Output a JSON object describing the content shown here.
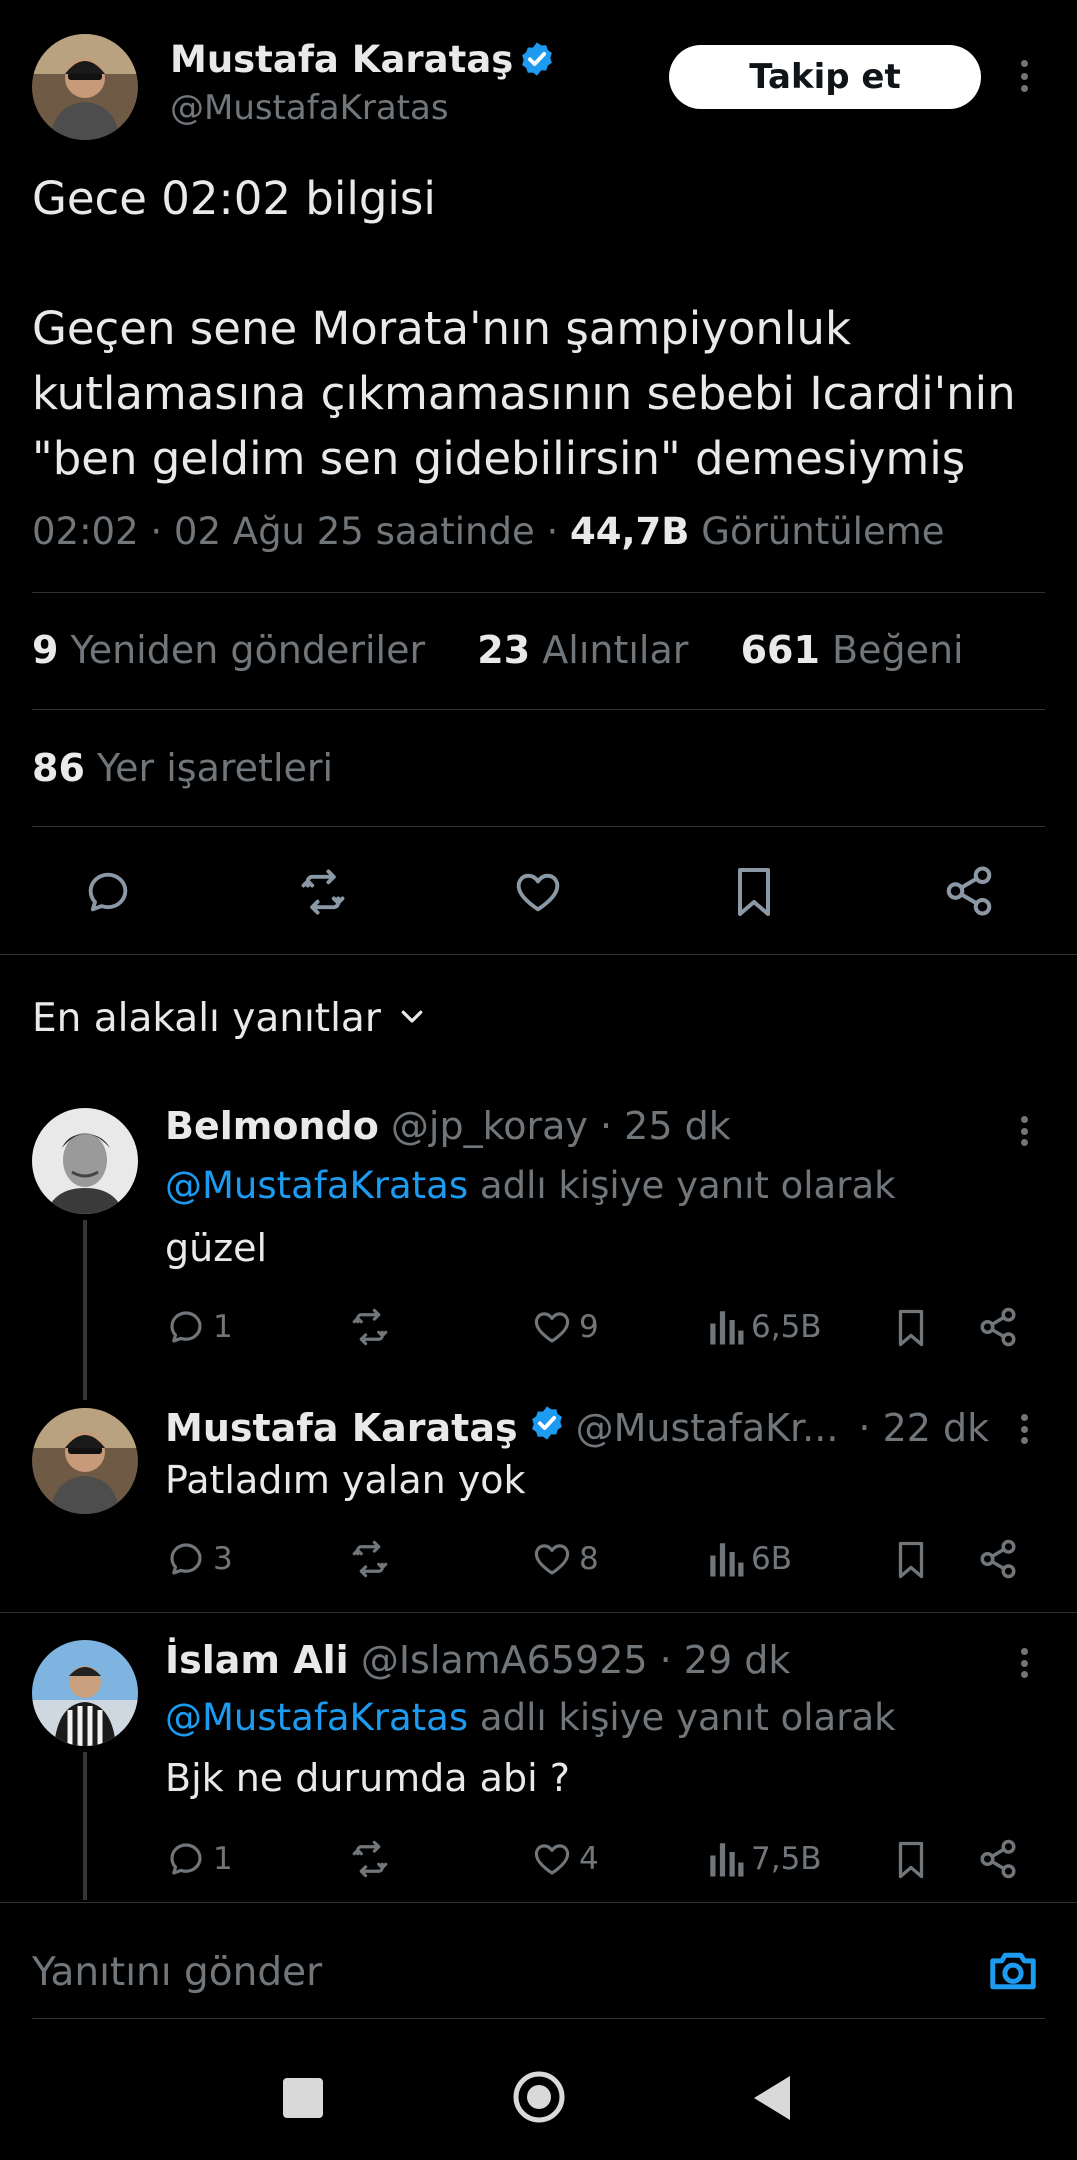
{
  "tweet": {
    "author_name": "Mustafa Karataş",
    "author_handle": "@MustafaKratas",
    "follow_label": "Takip et",
    "text_line1": "Gece 02:02 bilgisi",
    "text_line2": "Geçen sene Morata'nın şampiyonluk",
    "text_line3": "kutlamasına çıkmamasının sebebi Icardi'nin",
    "text_line4": "\"ben geldim sen gidebilirsin\" demesiymiş",
    "meta_time": "02:02 · 02 Ağu 25 saatinde ·",
    "views_count": "44,7B",
    "views_label": "Görüntüleme",
    "reposts_count": "9",
    "reposts_label": "Yeniden gönderiler",
    "quotes_count": "23",
    "quotes_label": "Alıntılar",
    "likes_count": "661",
    "likes_label": "Beğeni",
    "bookmarks_count": "86",
    "bookmarks_label": "Yer işaretleri"
  },
  "replies_sort": {
    "label": "En alakalı yanıtlar"
  },
  "replies": [
    {
      "name": "Belmondo",
      "handle_time": "@jp_koray · 25 dk",
      "reply_to_handle": "@MustafaKratas",
      "reply_to_suffix": "adlı kişiye yanıt olarak",
      "text": "güzel",
      "comments": "1",
      "likes": "9",
      "views": "6,5B"
    },
    {
      "name": "Mustafa Karataş",
      "handle": "@MustafaKr...",
      "time": "· 22 dk",
      "text": "Patladım yalan yok",
      "comments": "3",
      "likes": "8",
      "views": "6B"
    },
    {
      "name": "İslam Ali",
      "handle_time": "@IslamA65925 · 29 dk",
      "reply_to_handle": "@MustafaKratas",
      "reply_to_suffix": "adlı kişiye yanıt olarak",
      "text": "Bjk ne durumda abi ?",
      "comments": "1",
      "likes": "4",
      "views": "7,5B"
    }
  ],
  "composer": {
    "placeholder": "Yanıtını gönder"
  },
  "colors": {
    "background": "#000000",
    "accent": "#1d9bf0",
    "muted": "#71767b",
    "text": "#e7e9ea",
    "divider": "#2f3336"
  }
}
